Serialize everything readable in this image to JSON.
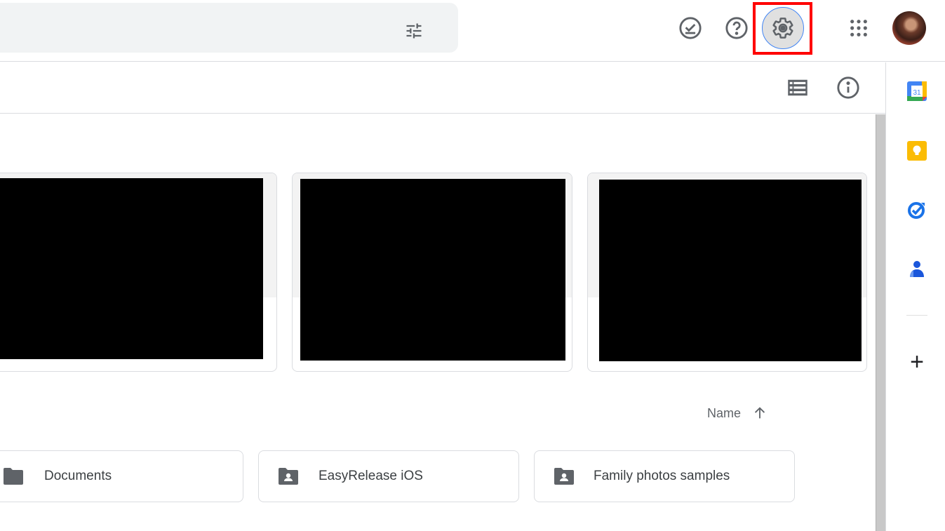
{
  "header": {
    "search_options_icon": "tune-icon",
    "icons": {
      "ready_offline": "offline-check-icon",
      "support": "help-icon",
      "settings": "gear-icon",
      "apps": "apps-grid-icon",
      "account": "avatar"
    }
  },
  "toolbar": {
    "view_toggle_icon": "list-view-icon",
    "details_icon": "info-icon"
  },
  "side_panel": {
    "items": [
      {
        "name": "calendar",
        "label": "31"
      },
      {
        "name": "keep"
      },
      {
        "name": "tasks"
      },
      {
        "name": "contacts"
      }
    ],
    "add_label": "+"
  },
  "suggested_files": [
    {
      "thumbnail": "redacted"
    },
    {
      "thumbnail": "redacted"
    },
    {
      "thumbnail": "redacted"
    }
  ],
  "sort": {
    "label": "Name",
    "direction_icon": "arrow-up-icon"
  },
  "folders": [
    {
      "name": "Documents",
      "type": "folder"
    },
    {
      "name": "EasyRelease iOS",
      "type": "shared-folder"
    },
    {
      "name": "Family photos samples",
      "type": "shared-folder"
    }
  ],
  "colors": {
    "highlight": "#ff0000",
    "focus_ring": "#4285f4",
    "icon_gray": "#5f6368"
  }
}
